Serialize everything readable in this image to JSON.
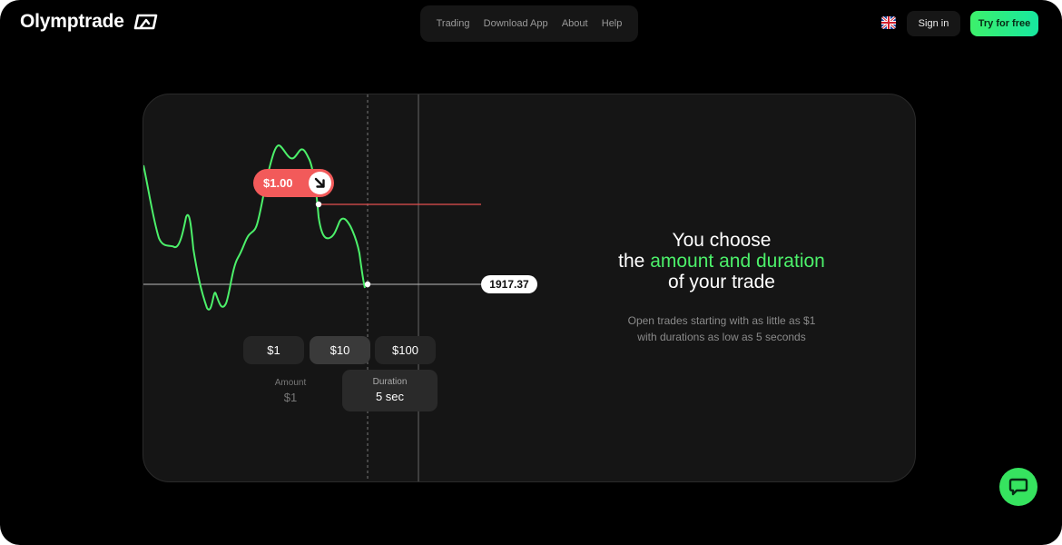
{
  "header": {
    "logo_text": "Olymptrade",
    "nav": [
      "Trading",
      "Download App",
      "About",
      "Help"
    ],
    "language_flag": "uk-flag-icon",
    "sign_in": "Sign in",
    "try_free": "Try for free"
  },
  "chart_demo": {
    "price_tag": "$1.00",
    "price_tag_icon": "arrow-down-right-icon",
    "level": "1917.37",
    "amount_options": [
      "$1",
      "$10",
      "$100"
    ],
    "selected_option": "$10",
    "amount_label": "Amount",
    "amount_value": "$1",
    "duration_label": "Duration",
    "duration_value": "5 sec"
  },
  "hero": {
    "line1": "You choose",
    "line2_prefix": "the",
    "line2_highlight": "amount and duration",
    "line3": "of your trade",
    "sub1": "Open trades starting with as little as $1",
    "sub2": "with durations as low as 5 seconds"
  },
  "colors": {
    "accent_green": "#4cf06a",
    "price_red": "#f25a5a",
    "background": "#000000",
    "card": "#151515"
  },
  "chat_icon": "chat-bubble-icon"
}
